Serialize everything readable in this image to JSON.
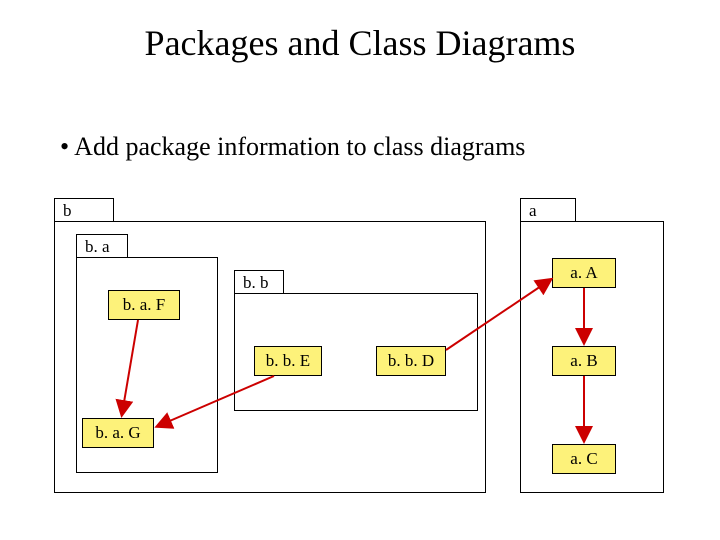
{
  "title": "Packages and Class Diagrams",
  "bullet": "•  Add package information to class diagrams",
  "packages": {
    "b": {
      "label": "b"
    },
    "ba": {
      "label": "b. a"
    },
    "bb": {
      "label": "b. b"
    },
    "a": {
      "label": "a"
    }
  },
  "classes": {
    "baF": "b. a. F",
    "baG": "b. a. G",
    "bbE": "b. b. E",
    "bbD": "b. b. D",
    "aA": "a. A",
    "aB": "a. B",
    "aC": "a. C"
  }
}
